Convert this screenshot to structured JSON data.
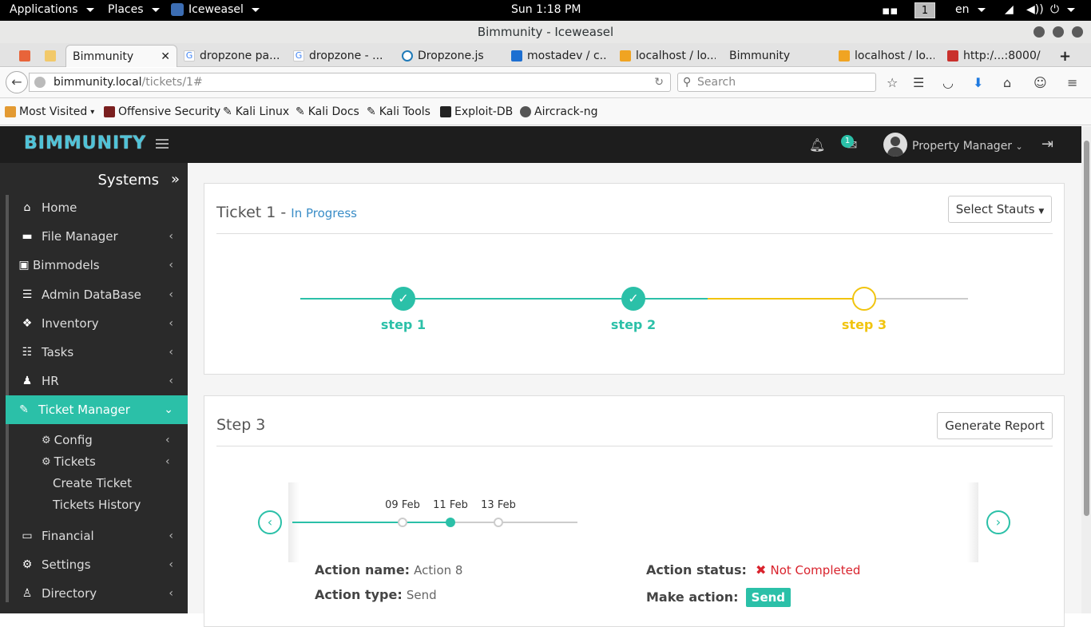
{
  "system_bar": {
    "applications": "Applications",
    "places": "Places",
    "browser": "Iceweasel",
    "clock": "Sun  1:18 PM",
    "workspace": "1",
    "language": "en"
  },
  "window": {
    "title": "Bimmunity - Iceweasel"
  },
  "tabs": [
    {
      "label": "Bimmunity",
      "active": true
    },
    {
      "label": "dropzone pa..."
    },
    {
      "label": "dropzone - ..."
    },
    {
      "label": "Dropzone.js"
    },
    {
      "label": "mostadev / c..."
    },
    {
      "label": "localhost / lo..."
    },
    {
      "label": "Bimmunity"
    },
    {
      "label": "localhost / lo..."
    },
    {
      "label": "http:/...:8000/"
    }
  ],
  "navbar": {
    "url_host": "bimmunity.local",
    "url_path": "/tickets/1#",
    "search_placeholder": "Search"
  },
  "bookmarks": [
    "Most Visited",
    "Offensive Security",
    "Kali Linux",
    "Kali Docs",
    "Kali Tools",
    "Exploit-DB",
    "Aircrack-ng"
  ],
  "header": {
    "logo": "BIMMUNITY",
    "notification_count": "1",
    "user": "Property Manager"
  },
  "sidebar": {
    "title": "Systems",
    "items": [
      {
        "label": "Home",
        "icon": "home-icon"
      },
      {
        "label": "File Manager",
        "icon": "folder-icon"
      },
      {
        "label": "Bimmodels",
        "icon": "model-icon"
      },
      {
        "label": "Admin DataBase",
        "icon": "database-icon"
      },
      {
        "label": "Inventory",
        "icon": "cubes-icon"
      },
      {
        "label": "Tasks",
        "icon": "tasks-icon"
      },
      {
        "label": "HR",
        "icon": "users-icon"
      },
      {
        "label": "Ticket Manager",
        "icon": "ticket-icon",
        "active": true
      },
      {
        "label": "Financial",
        "icon": "money-icon"
      },
      {
        "label": "Settings",
        "icon": "gears-icon"
      },
      {
        "label": "Directory",
        "icon": "user-icon"
      }
    ],
    "sub_items": [
      {
        "label": "Config"
      },
      {
        "label": "Tickets"
      }
    ],
    "sub_sub_items": [
      {
        "label": "Create Ticket"
      },
      {
        "label": "Tickets History"
      }
    ]
  },
  "ticket": {
    "title": "Ticket 1 - ",
    "status": "In Progress",
    "select_status_label": "Select Stauts",
    "steps": [
      {
        "label": "step 1",
        "state": "done"
      },
      {
        "label": "step 2",
        "state": "done"
      },
      {
        "label": "step 3",
        "state": "current"
      }
    ]
  },
  "step_panel": {
    "title": "Step 3",
    "report_button": "Generate Report",
    "timeline_dates": [
      "09 Feb",
      "11 Feb",
      "13 Feb"
    ],
    "selected_date_index": 1,
    "action_name_label": "Action name:",
    "action_name": "Action 8",
    "action_type_label": "Action type:",
    "action_type": "Send",
    "action_status_label": "Action status:",
    "action_status": "Not Completed",
    "make_action_label": "Make action:",
    "make_action_button": "Send"
  },
  "colors": {
    "accent": "#2bc0a8",
    "pending": "#f1c40f",
    "link": "#3a8dc7",
    "error": "#d9232d"
  }
}
